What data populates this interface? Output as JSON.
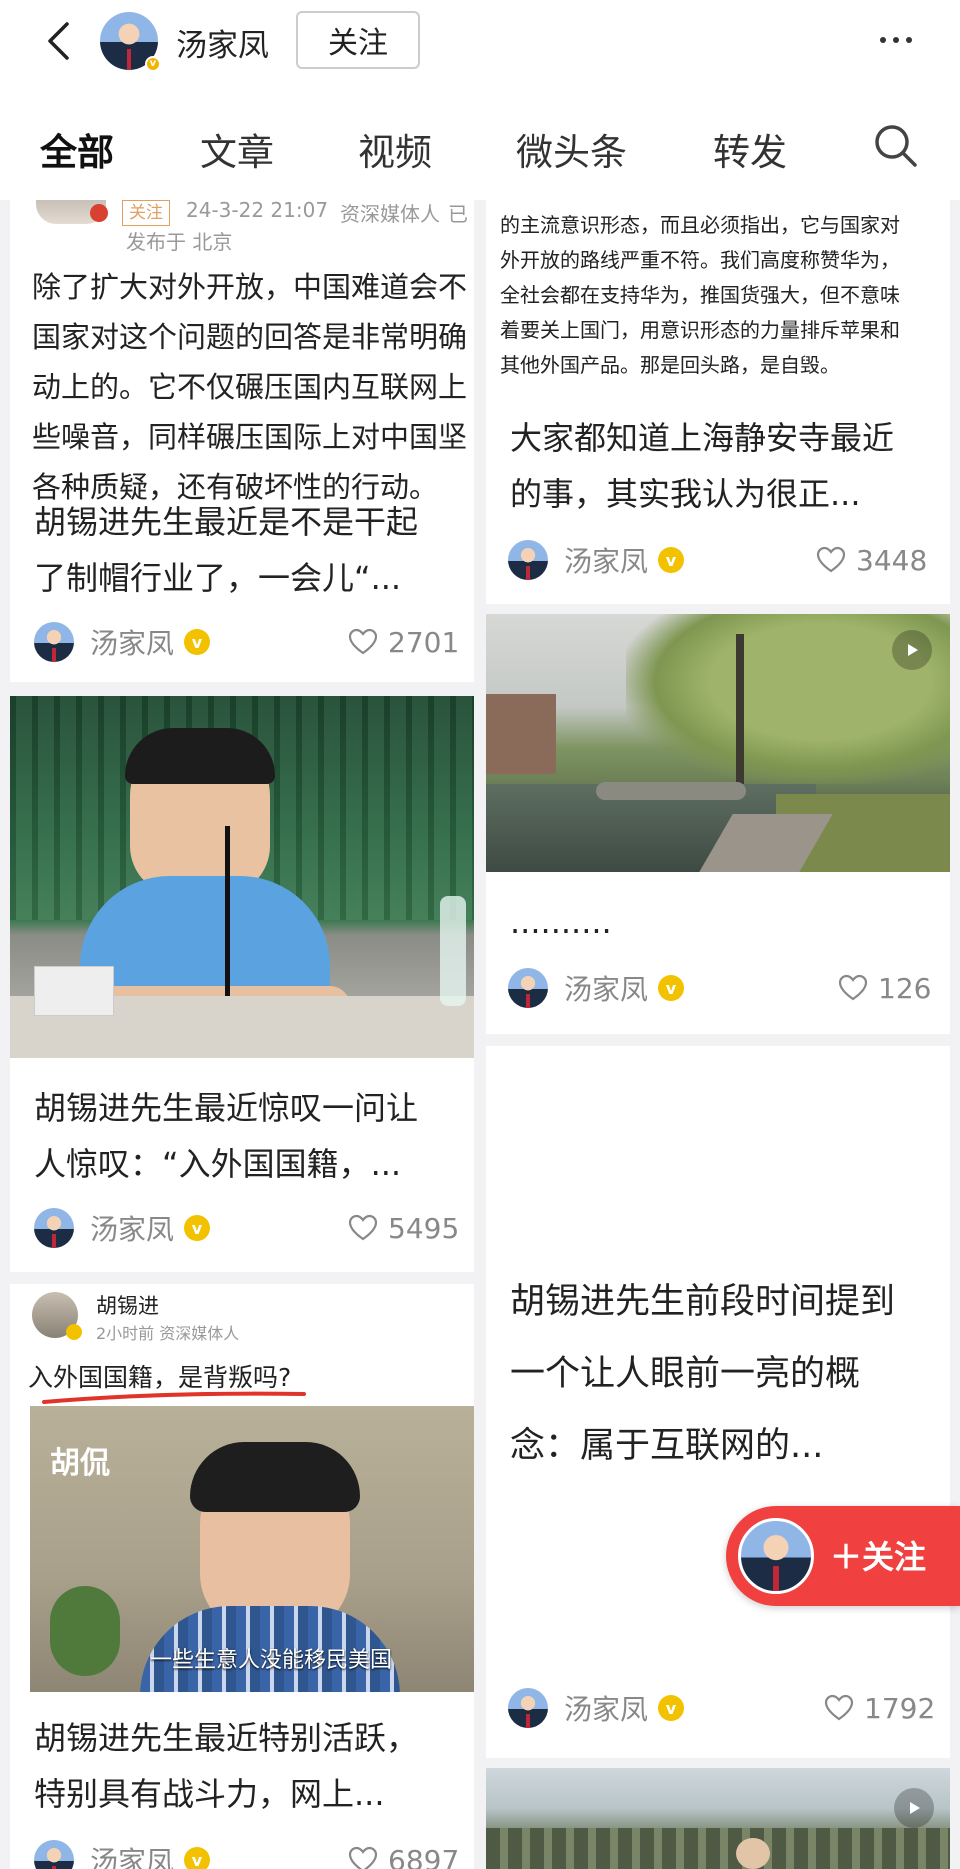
{
  "header": {
    "back_icon": "chevron-left-icon",
    "author_name": "汤家凤",
    "follow_label": "关注",
    "more_icon": "more-dots-icon"
  },
  "tabs": [
    {
      "label": "全部",
      "active": true
    },
    {
      "label": "文章",
      "active": false
    },
    {
      "label": "视频",
      "active": false
    },
    {
      "label": "微头条",
      "active": false
    },
    {
      "label": "转发",
      "active": false
    }
  ],
  "search_icon": "search-icon",
  "feed": {
    "card1": {
      "shot_follow": "关注",
      "shot_time": "24-3-22 21:07",
      "shot_role": "资深媒体人",
      "shot_role_cut": "已",
      "shot_location": "发布于 北京",
      "shot_lines": [
        "除了扩大对外开放，中国难道会不",
        "国家对这个问题的回答是非常明确",
        "动上的。它不仅碾压国内互联网上",
        "些噪音，同样碾压国际上对中国坚",
        "各种质疑，还有破坏性的行动。"
      ],
      "title": "胡锡进先生最近是不是干起了制帽行业了，一会儿“...",
      "author": "汤家凤",
      "likes": "2701"
    },
    "card2": {
      "title": "胡锡进先生最近惊叹一问让人惊叹：“入外国国籍，...",
      "author": "汤家凤",
      "likes": "5495"
    },
    "card3": {
      "shot_author": "胡锡进",
      "shot_meta": "2小时前  资深媒体人",
      "shot_headline": "入外国国籍，是背叛吗?",
      "shot_watermark": "胡侃",
      "shot_subtitle": "一些生意人没能移民美国",
      "title": "胡锡进先生最近特别活跃，特别具有战斗力，网上...",
      "author": "汤家凤",
      "likes": "6897"
    },
    "card4": {
      "shot_lines": [
        "的主流意识形态，而且必须指出，它与国家对",
        "外开放的路线严重不符。我们高度称赞华为，",
        "全社会都在支持华为，推国货强大，但不意味",
        "着要关上国门，用意识形态的力量排斥苹果和",
        "其他外国产品。那是回头路，是自毁。"
      ],
      "title": "大家都知道上海静安寺最近的事，其实我认为很正...",
      "author": "汤家凤",
      "likes": "3448"
    },
    "card5": {
      "title": "..........",
      "author": "汤家凤",
      "likes": "126"
    },
    "card6": {
      "title": "胡锡进先生前段时间提到一个让人眼前一亮的概念：属于互联网的...",
      "author": "汤家凤",
      "likes": "1792"
    }
  },
  "float_follow": {
    "label": "＋关注"
  },
  "colors": {
    "accent": "#f04040",
    "verified": "#f2c200",
    "background": "#f2f2f4"
  }
}
